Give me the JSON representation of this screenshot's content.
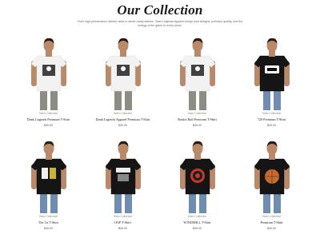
{
  "header": {
    "title": "Our Collection",
    "subtitle": "From high-performance athletic wear to street-ready fashion, Slam Legends Apparel brings bold designs, premium quality, and the energy of the game to every piece."
  },
  "products": [
    {
      "brand": "Slam Collection",
      "name": "Dunk Legends Premium T-Shirt",
      "price": "$49.00",
      "shirt": "white",
      "graphic": "dunk-player-graphic"
    },
    {
      "brand": "Slam Collection",
      "name": "Dunk Legends Apparel Premium T-Shirt",
      "price": "$49.00",
      "shirt": "white",
      "graphic": "ball-player-graphic"
    },
    {
      "brand": "Slam Collection",
      "name": "Basket Ball Premium T-Shirt",
      "price": "$49.00",
      "shirt": "white",
      "graphic": "basket-hoop-graphic"
    },
    {
      "brand": "Slam Collection",
      "name": "720 Premium T-Shirt",
      "price": "$49.00",
      "shirt": "black",
      "graphic": "720-text-graphic"
    },
    {
      "brand": "Slam Collection",
      "name": "The 1st T-Shirt",
      "price": "$49.00",
      "shirt": "black",
      "graphic": "the-1st-graphic"
    },
    {
      "brand": "Slam Collection",
      "name": "OOP T-Shirt",
      "price": "$49.00",
      "shirt": "black",
      "graphic": "oop-graphic"
    },
    {
      "brand": "Slam Collection",
      "name": "WINDMILL T-Shirt",
      "price": "$49.00",
      "shirt": "black",
      "graphic": "windmill-dartboard-graphic"
    },
    {
      "brand": "Slam Collection",
      "name": "Premium T-Shirt",
      "price": "$49.00",
      "shirt": "black",
      "graphic": "basketball-graphic"
    }
  ],
  "colors": {
    "shirt_white": "#f2f2f2",
    "shirt_black": "#151515",
    "pants_top": "#8c8c82",
    "pants_bottom": "#6f8db0",
    "skin": "#b98a6a",
    "hair": "#2a1c14"
  }
}
